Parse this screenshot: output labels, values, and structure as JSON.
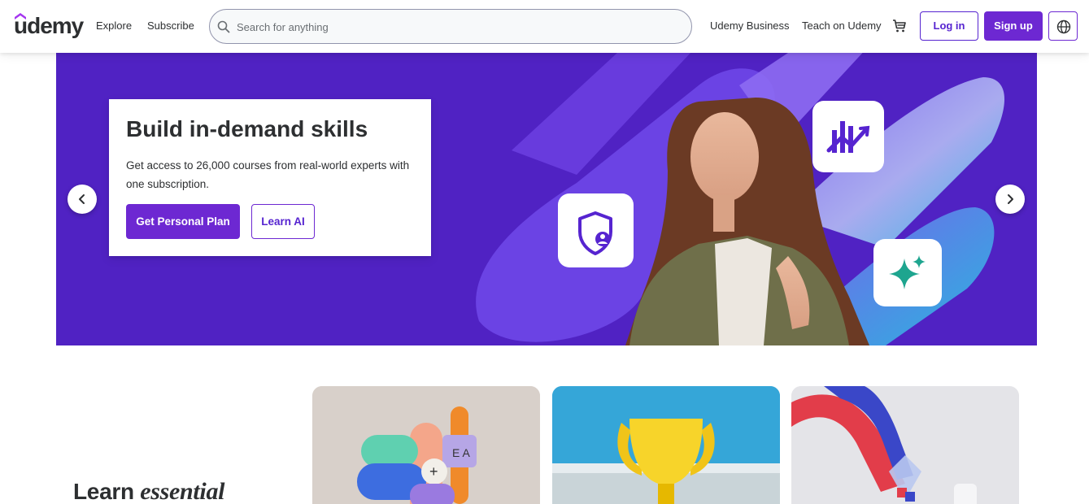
{
  "header": {
    "logo": "udemy",
    "nav": {
      "explore": "Explore",
      "subscribe": "Subscribe",
      "business": "Udemy Business",
      "teach": "Teach on Udemy"
    },
    "search": {
      "placeholder": "Search for anything",
      "value": ""
    },
    "login": "Log in",
    "signup": "Sign up"
  },
  "hero": {
    "title": "Build in-demand skills",
    "subtitle": "Get access to 26,000 courses from real-world experts with one subscription.",
    "primary_button": "Get Personal Plan",
    "secondary_button": "Learn AI",
    "feature_icons": [
      "shield-user-icon",
      "chart-growth-icon",
      "sparkle-icon"
    ]
  },
  "section": {
    "heading_plain": "Learn ",
    "heading_italic": "essential"
  },
  "colors": {
    "brand": "#6d28d2",
    "brand_dark": "#5624d0",
    "hero_bg": "#5022c3",
    "teal": "#1ea58f",
    "text": "#2d2f31"
  }
}
